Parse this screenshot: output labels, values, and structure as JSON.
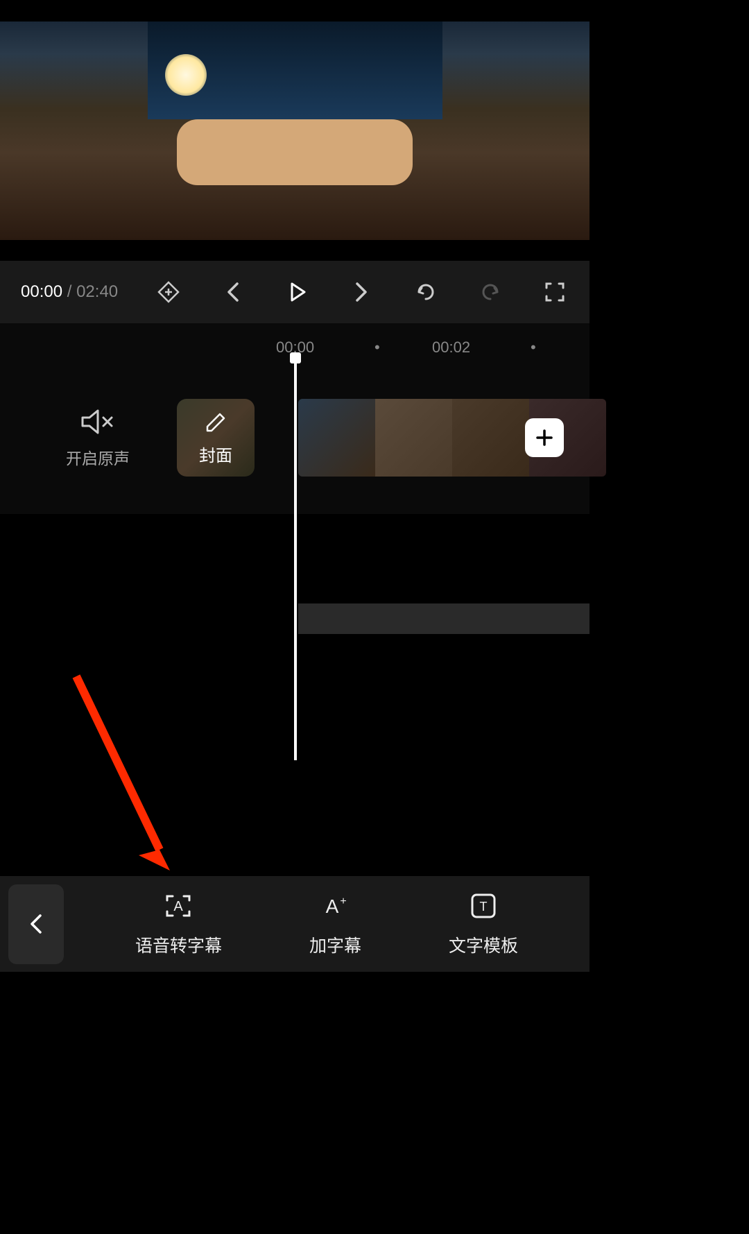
{
  "playback": {
    "current_time": "00:00",
    "separator": " / ",
    "total_time": "02:40"
  },
  "timeline": {
    "ruler_mark_1": "00:00",
    "ruler_dot_1": "•",
    "ruler_mark_2": "00:02",
    "ruler_dot_2": "•"
  },
  "original_sound": {
    "label": "开启原声"
  },
  "cover": {
    "label": "封面"
  },
  "toolbar": {
    "items": [
      {
        "label": "语音转字幕"
      },
      {
        "label": "加字幕"
      },
      {
        "label": "文字模板"
      }
    ]
  },
  "icons": {
    "keyframe": "keyframe-icon",
    "prev": "prev-icon",
    "play": "play-icon",
    "next": "next-icon",
    "undo": "undo-icon",
    "redo": "redo-icon",
    "fullscreen": "fullscreen-icon",
    "speaker_muted": "speaker-muted-icon",
    "pencil": "pencil-icon",
    "plus": "plus-icon",
    "back": "back-icon",
    "auto_caption": "auto-caption-icon",
    "add_caption": "add-caption-icon",
    "text_template": "text-template-icon"
  }
}
